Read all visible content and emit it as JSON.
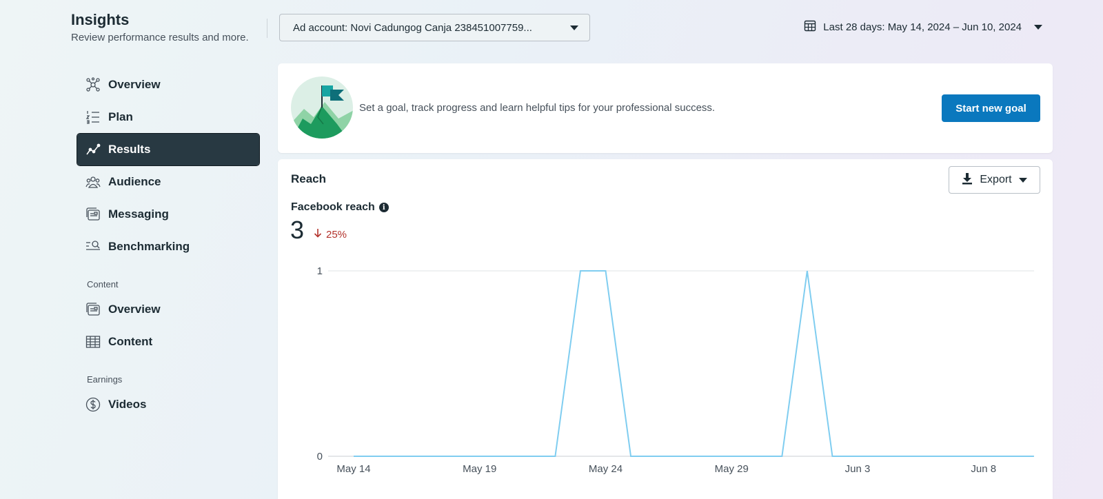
{
  "header": {
    "title": "Insights",
    "subtitle": "Review performance results and more.",
    "account_select": "Ad account: Novi Cadungog Canja 238451007759...",
    "date_range": "Last 28 days: May 14, 2024 – Jun 10, 2024"
  },
  "sidebar": {
    "items": [
      {
        "label": "Overview",
        "icon": "overview-network-icon"
      },
      {
        "label": "Plan",
        "icon": "plan-list-icon"
      },
      {
        "label": "Results",
        "icon": "results-trend-icon",
        "active": true
      },
      {
        "label": "Audience",
        "icon": "audience-people-icon"
      },
      {
        "label": "Messaging",
        "icon": "messaging-icon"
      },
      {
        "label": "Benchmarking",
        "icon": "benchmarking-icon"
      }
    ],
    "content_section": "Content",
    "content_items": [
      {
        "label": "Overview",
        "icon": "content-overview-icon"
      },
      {
        "label": "Content",
        "icon": "table-grid-icon"
      }
    ],
    "earnings_section": "Earnings",
    "earnings_items": [
      {
        "label": "Videos",
        "icon": "dollar-circle-icon"
      }
    ]
  },
  "goal_card": {
    "message": "Set a goal, track progress and learn helpful tips for your professional success.",
    "button": "Start new goal"
  },
  "reach_card": {
    "title": "Reach",
    "export": "Export",
    "metric_label": "Facebook reach",
    "metric_value": "3",
    "metric_change": "25%"
  },
  "colors": {
    "accent": "#0a78be",
    "sidebar_active": "#283942",
    "line": "#7fcdf0",
    "negative": "#b3322b"
  },
  "chart_data": {
    "type": "line",
    "x": [
      "May 14",
      "May 15",
      "May 16",
      "May 17",
      "May 18",
      "May 19",
      "May 20",
      "May 21",
      "May 22",
      "May 23",
      "May 24",
      "May 25",
      "May 26",
      "May 27",
      "May 28",
      "May 29",
      "May 30",
      "May 31",
      "Jun 1",
      "Jun 2",
      "Jun 3",
      "Jun 4",
      "Jun 5",
      "Jun 6",
      "Jun 7",
      "Jun 8",
      "Jun 9",
      "Jun 10"
    ],
    "series": [
      {
        "values": [
          0,
          0,
          0,
          0,
          0,
          0,
          0,
          0,
          0,
          1,
          1,
          0,
          0,
          0,
          0,
          0,
          0,
          0,
          1,
          0,
          0,
          0,
          0,
          0,
          0,
          0,
          0,
          0
        ]
      }
    ],
    "x_ticks": [
      "May 14",
      "May 19",
      "May 24",
      "May 29",
      "Jun 3",
      "Jun 8"
    ],
    "y_ticks": [
      "1",
      "0"
    ],
    "ylim": [
      0,
      1
    ],
    "grid": true
  }
}
